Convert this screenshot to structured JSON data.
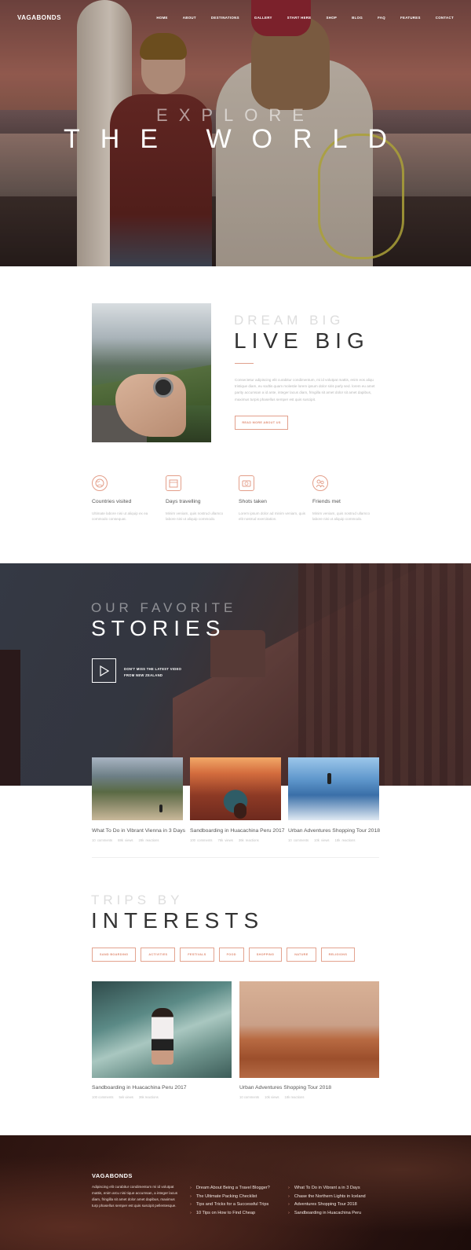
{
  "nav": {
    "logo": "VAGABONDS",
    "items": [
      "HOME",
      "ABOUT",
      "DESTINATIONS",
      "GALLERY",
      "START HERE",
      "SHOP",
      "BLOG",
      "FAQ",
      "FEATURES",
      "CONTACT"
    ]
  },
  "hero": {
    "subtitle": "EXPLORE",
    "title": "THE WORLD"
  },
  "about": {
    "subtitle": "DREAM BIG",
    "title": "LIVE BIG",
    "text": "Consectetur adipiscing elit curabitur condimentum, mi id volutpat mattis, enim eos aliqu tristique diam, eu sodtis quam molestie lorem ipsum dolor siris parly sed. lorem eu amet parity accumsan a id ante, integer lacus diam, fringilla sit amet dolor sit amet dapibus, maximus turpis phasellus semper est quis suscipit.",
    "button": "READ MORE ABOUT US"
  },
  "stats": [
    {
      "icon": "globe-icon",
      "title": "Countries visited",
      "text": "Ultimate labore nisi ut aliquip ex ea commodo consequat."
    },
    {
      "icon": "calendar-icon",
      "title": "Days travelling",
      "text": "Minim veniam, quis nostrud ullamco labore nisi ut aliquip commodo."
    },
    {
      "icon": "camera-icon",
      "title": "Shots taken",
      "text": "Lorem ipsum dolor ad minim veniam, quis elit nostrud exercitation."
    },
    {
      "icon": "friends-icon",
      "title": "Friends met",
      "text": "Minim veniam, quis nostrud ullamco labore nisi ut aliquip commodo."
    }
  ],
  "stories": {
    "subtitle": "OUR FAVORITE",
    "title": "STORIES",
    "video_line1": "DON'T MISS THE LATEST VIDEO",
    "video_line2": "FROM NEW ZEALAND",
    "cards": [
      {
        "title": "What To Do in Vibrant Vienna in 3 Days",
        "comments": "10 comments",
        "views": "88k views",
        "reactions": "28k reactions"
      },
      {
        "title": "Sandboarding in Huacachina Peru 2017",
        "comments": "100 comments",
        "views": "76k views",
        "reactions": "36k reactions"
      },
      {
        "title": "Urban Adventures Shopping Tour 2018",
        "comments": "10 comments",
        "views": "10k views",
        "reactions": "18k reactions"
      }
    ]
  },
  "trips": {
    "subtitle": "TRIPS BY",
    "title": "INTERESTS",
    "filters": [
      "SAND BOARDING",
      "ACTIVITIES",
      "FESTIVALS",
      "FOOD",
      "SHOPPING",
      "NATURE",
      "RELIGIONS"
    ],
    "cards": [
      {
        "title": "Sandboarding in Huacachina Peru 2017",
        "comments": "100 comments",
        "views": "5ek views",
        "reactions": "36k reactions"
      },
      {
        "title": "Urban Adventures Shopping Tour 2018",
        "comments": "10 comments",
        "views": "10k views",
        "reactions": "18k reactions"
      }
    ]
  },
  "footer": {
    "logo": "VAGABONDS",
    "text": "Adipiscing elit curabitur condimentum mi id volutpat mattis, enim arcu nisi tique accumsan, a integer lacus diam, fringilla sit amet dolor amet dapibus, maximus turp phasellus semper est quis suscipit pellentesque.",
    "list1": [
      "Dream About Being a Travel Blogger?",
      "The Ultimate Packing Checklist",
      "Tips and Tricks for a Successful Trips",
      "10 Tips on How to Find Cheap"
    ],
    "list2": [
      "What To Do in Vibrant a in 3 Days",
      "Chase the Northern Lights in Iceland",
      "Adventures Shopping Tour 2018",
      "Sandboarding in Huacachina Peru"
    ]
  }
}
